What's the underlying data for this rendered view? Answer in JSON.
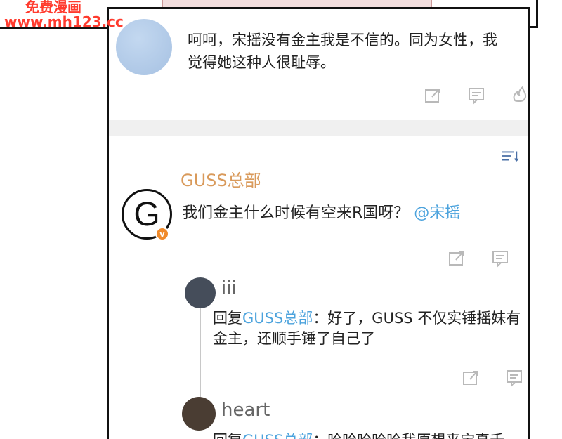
{
  "watermark": {
    "line1": "免费漫画",
    "line2": "www.mh123.cc"
  },
  "comment_top": {
    "text": "呵呵，宋摇没有金主我是不信的。同为女性，我觉得她这种人很耻辱。",
    "icons": [
      "share-icon",
      "comment-icon",
      "like-icon"
    ]
  },
  "sort_icon": "sort-icon",
  "comment_main": {
    "author": "GUSS总部",
    "avatar_letter": "G",
    "badge": "v",
    "text": "我们金主什么时候有空来R国呀？",
    "mention": "@宋摇",
    "icons": [
      "share-icon",
      "comment-icon"
    ]
  },
  "replies": [
    {
      "author": "iii",
      "reply_prefix": "回复",
      "reply_to": "GUSS总部",
      "text": "：好了，GUSS 不仅实锤摇妹有金主，还顺手锤了自己了",
      "icons": [
        "share-icon",
        "comment-icon"
      ]
    },
    {
      "author": "heart",
      "reply_prefix": "回复",
      "reply_to": "GUSS总部",
      "text": "：哈哈哈哈哈我原想来宝真千"
    }
  ],
  "colors": {
    "author": "#d99a5b",
    "link": "#4ca3dd",
    "icon": "#b9b9b9",
    "badge": "#f08a2a"
  }
}
